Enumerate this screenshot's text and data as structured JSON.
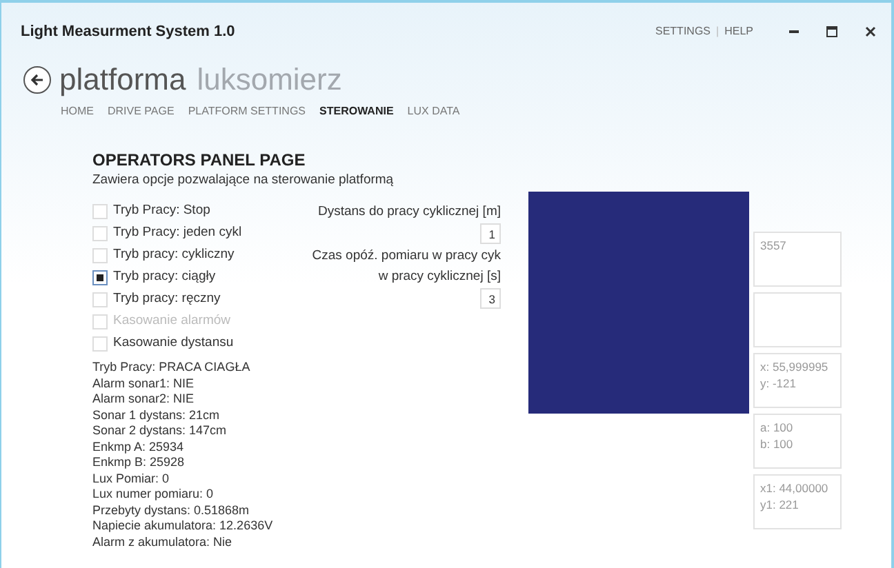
{
  "window": {
    "title": "Light Measurment System 1.0",
    "links": [
      "SETTINGS",
      "HELP"
    ],
    "separator": "|"
  },
  "header": {
    "title": "platforma",
    "subtitle": "luksomierz"
  },
  "nav": [
    {
      "label": "HOME",
      "selected": false
    },
    {
      "label": "DRIVE PAGE",
      "selected": false
    },
    {
      "label": "PLATFORM SETTINGS",
      "selected": false
    },
    {
      "label": "STEROWANIE",
      "selected": true
    },
    {
      "label": "LUX DATA",
      "selected": false
    }
  ],
  "page": {
    "title": "OPERATORS PANEL PAGE",
    "description": "Zawiera opcje pozwalające na sterowanie platformą"
  },
  "options": [
    {
      "label": "Tryb Pracy: Stop",
      "checked": false,
      "disabled": false
    },
    {
      "label": "Tryb Pracy: jeden cykl",
      "checked": false,
      "disabled": false
    },
    {
      "label": "Tryb pracy: cykliczny",
      "checked": false,
      "disabled": false
    },
    {
      "label": "Tryb pracy: ciągły",
      "checked": true,
      "disabled": false
    },
    {
      "label": "Tryb pracy: ręczny",
      "checked": false,
      "disabled": false
    },
    {
      "label": "Kasowanie alarmów",
      "checked": false,
      "disabled": true
    },
    {
      "label": "Kasowanie dystansu",
      "checked": false,
      "disabled": false
    }
  ],
  "parameters": [
    {
      "label_lines": [
        "Dystans do pracy cyklicznej [m]"
      ],
      "value": "1"
    },
    {
      "label_lines": [
        "Czas opóź. pomiaru w pracy cyk",
        "w pracy cyklicznej [s]"
      ],
      "value": "3"
    }
  ],
  "status": [
    "Tryb Pracy:  PRACA CIAGŁA",
    "Alarm sonar1: NIE",
    "Alarm sonar2: NIE",
    "Sonar 1 dystans: 21cm",
    "Sonar 2 dystans: 147cm",
    "Enkmp A: 25934",
    "Enkmp B: 25928",
    "Lux Pomiar: 0",
    "Lux numer pomiaru: 0",
    "Przebyty dystans: 0.51868m",
    "Napiecie akumulatora: 12.2636V",
    "Alarm z akumulatora: Nie"
  ],
  "readouts": [
    {
      "kind": "text",
      "lines": [
        "3557"
      ]
    },
    {
      "kind": "empty"
    },
    {
      "kind": "text",
      "lines": [
        "x: 55,999995",
        "y: -121"
      ]
    },
    {
      "kind": "text",
      "lines": [
        "a: 100",
        "b: 100"
      ]
    },
    {
      "kind": "text",
      "lines": [
        "x1: 44,00000",
        "y1: 221"
      ]
    }
  ]
}
